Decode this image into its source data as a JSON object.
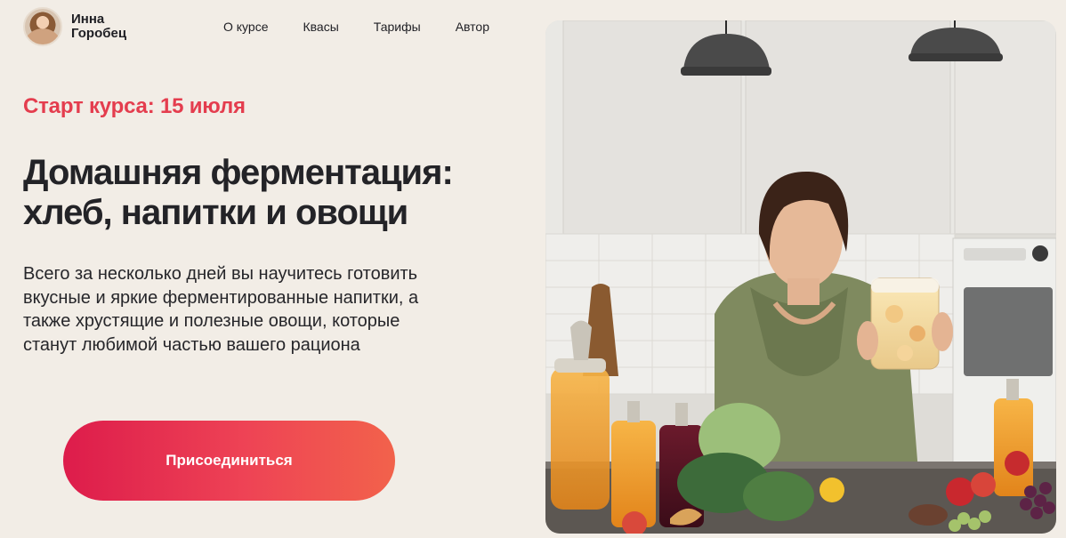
{
  "header": {
    "brand": {
      "first_name": "Инна",
      "last_name": "Горобец"
    },
    "nav": [
      {
        "label": "О курсе"
      },
      {
        "label": "Квасы"
      },
      {
        "label": "Тарифы"
      },
      {
        "label": "Автор"
      }
    ]
  },
  "hero": {
    "start_label": "Старт курса: 15 июля",
    "title_lines": [
      "Домашняя ферментация:",
      "хлеб, напитки и овощи"
    ],
    "description_lines": [
      "Всего за несколько дней вы научитесь готовить",
      "вкусные и яркие ферментированные напитки, а",
      "также хрустящие и полезные овощи, которые",
      "станут любимой частью вашего рациона"
    ],
    "cta_label": "Присоединиться"
  },
  "colors": {
    "background": "#f2ede6",
    "accent": "#e43d4e",
    "cta_gradient": [
      "#dd1c4b",
      "#f2624b"
    ],
    "text": "#1f1f24"
  },
  "icons": {
    "avatar": "author-portrait",
    "photo": "kitchen-fermentation-photo"
  }
}
